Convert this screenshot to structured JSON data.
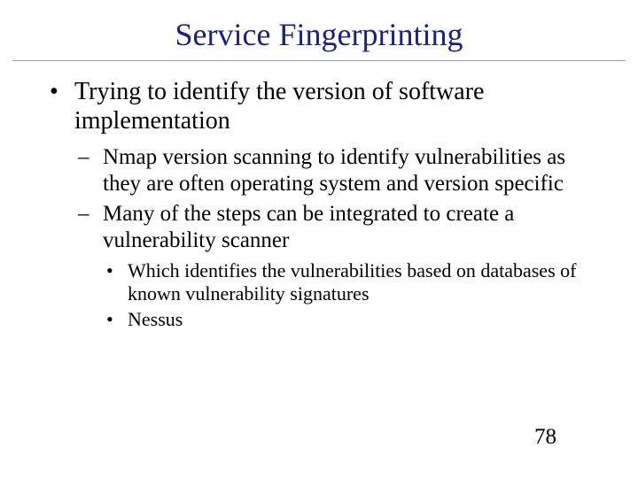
{
  "title": "Service Fingerprinting",
  "bullets": {
    "l1_0": "Trying to identify the version of software implementation",
    "l2_0": "Nmap version scanning to identify vulnerabilities as they are often operating system and version specific",
    "l2_1": "Many of the steps can be integrated to create a vulnerability scanner",
    "l3_0": "Which identifies the vulnerabilities based on databases of known vulnerability signatures",
    "l3_1": "Nessus"
  },
  "page_number": "78"
}
